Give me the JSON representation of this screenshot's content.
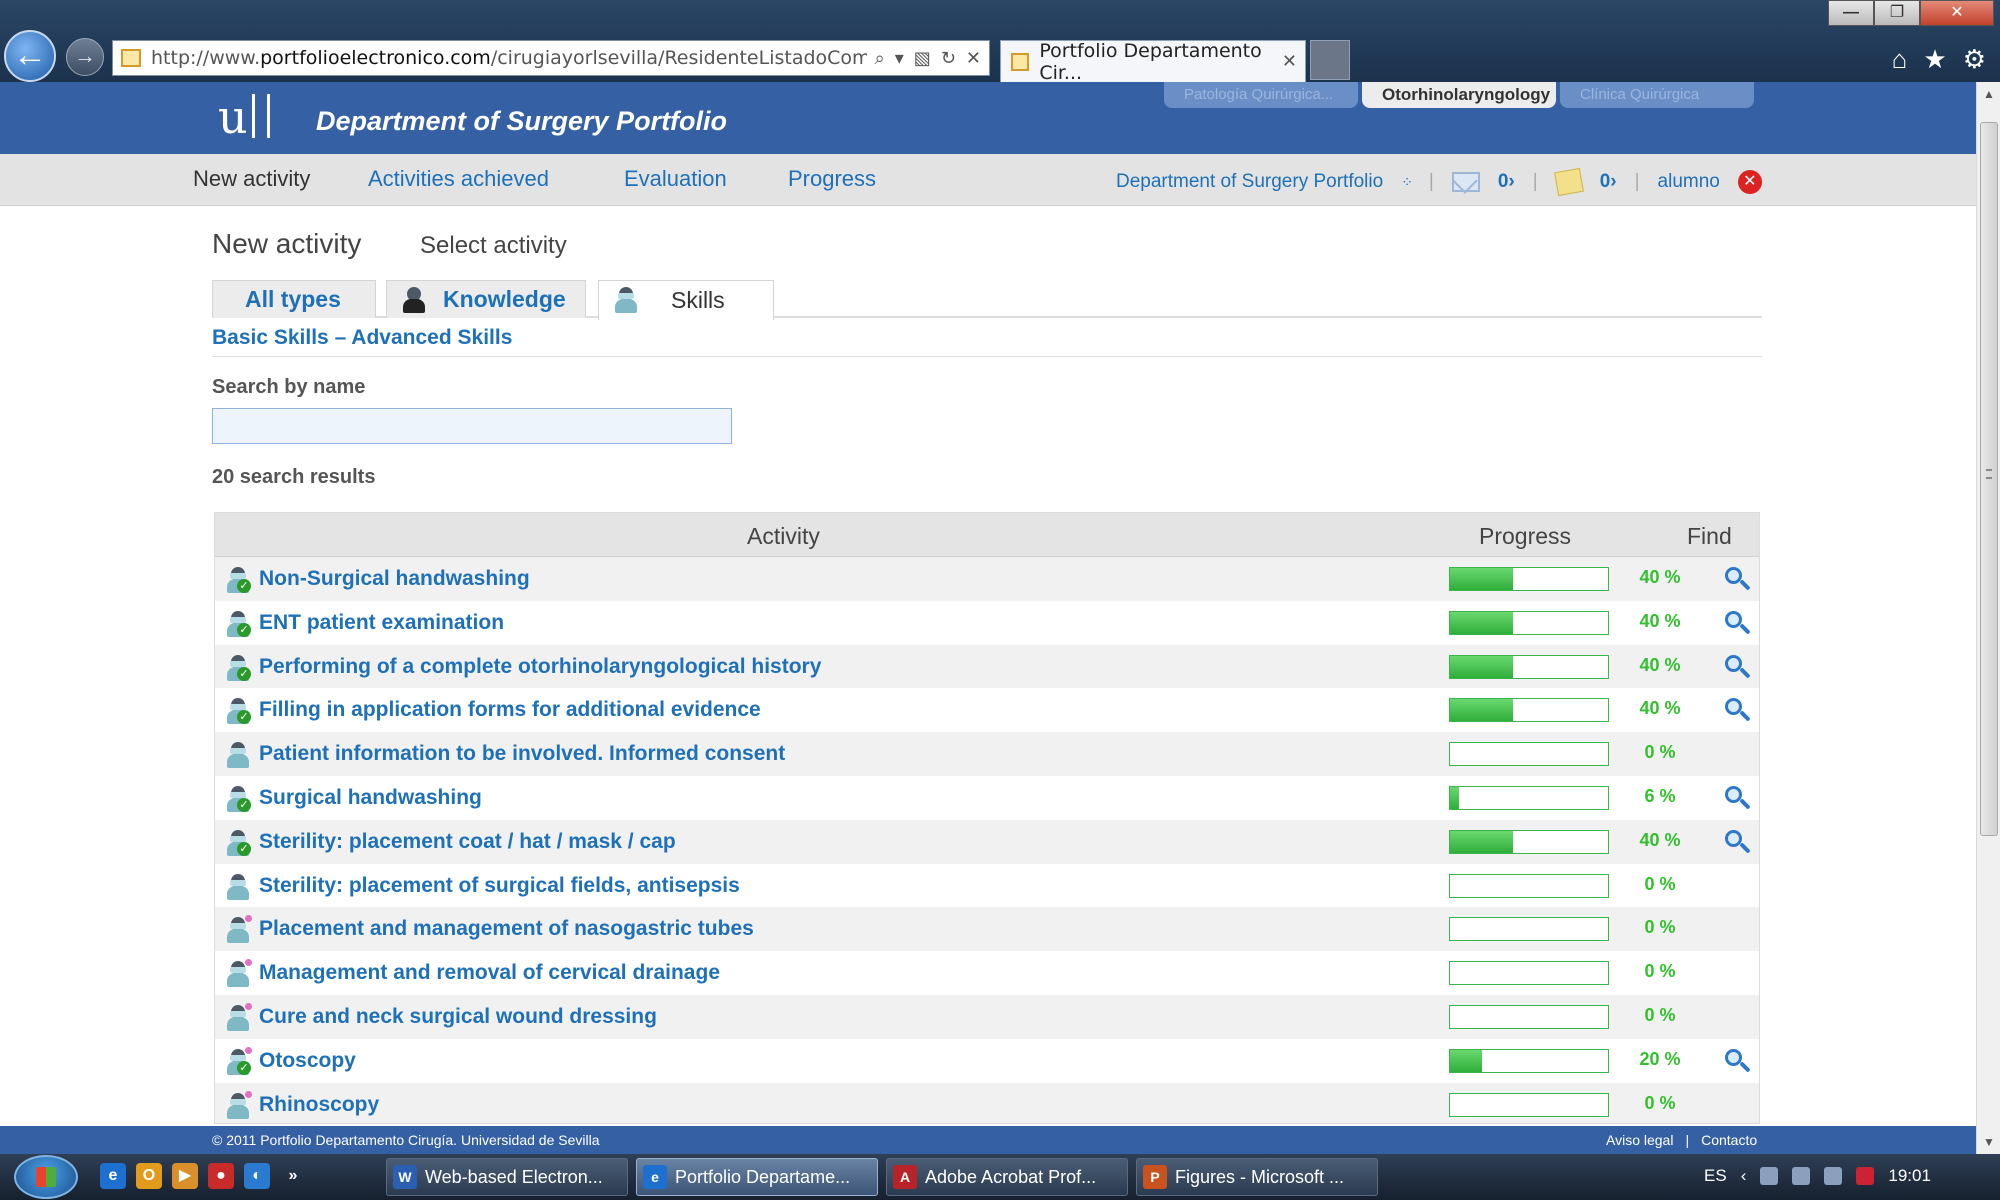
{
  "browser": {
    "url_prefix": "http://www.",
    "url_domain": "portfolioelectronico.com",
    "url_path": "/cirugiayorlsevilla/ResidenteListadoCompetenci",
    "tab_title": "Portfolio Departamento Cir...",
    "window_controls": [
      "—",
      "❐",
      "✕"
    ]
  },
  "site": {
    "title": "Department of Surgery Portfolio",
    "subject_tabs": [
      "Patología Quirúrgica...",
      "Otorhinolaryngology",
      "Clínica Quirúrgica"
    ],
    "active_subject": "Otorhinolaryngology"
  },
  "nav": {
    "items": [
      "New activity",
      "Activities achieved",
      "Evaluation",
      "Progress"
    ],
    "portfolio_link": "Department of Surgery Portfolio",
    "messages": "0›",
    "notes": "0›",
    "user": "alumno"
  },
  "page": {
    "heading": "New activity",
    "subheading": "Select activity",
    "type_tabs": [
      "All types",
      "Knowledge",
      "Skills"
    ],
    "active_type": "Skills",
    "crumb": "Basic Skills – Advanced Skills",
    "search_label": "Search by name",
    "search_value": "",
    "result_count": "20 search results"
  },
  "table": {
    "columns": [
      "Activity",
      "Progress",
      "Find"
    ],
    "rows": [
      {
        "activity": "Non-Surgical handwashing",
        "progress": 40,
        "progress_label": "40 %",
        "find": true,
        "icon": "skill-done"
      },
      {
        "activity": "ENT patient examination",
        "progress": 40,
        "progress_label": "40 %",
        "find": true,
        "icon": "skill-done"
      },
      {
        "activity": "Performing of a complete otorhinolaryngological history",
        "progress": 40,
        "progress_label": "40 %",
        "find": true,
        "icon": "skill-done"
      },
      {
        "activity": "Filling in application forms for additional evidence",
        "progress": 40,
        "progress_label": "40 %",
        "find": true,
        "icon": "skill-done"
      },
      {
        "activity": "Patient information to be involved. Informed consent",
        "progress": 0,
        "progress_label": "0 %",
        "find": false,
        "icon": "skill"
      },
      {
        "activity": "Surgical handwashing",
        "progress": 6,
        "progress_label": "6 %",
        "find": true,
        "icon": "skill-done"
      },
      {
        "activity": "Sterility: placement coat / hat / mask / cap",
        "progress": 40,
        "progress_label": "40 %",
        "find": true,
        "icon": "skill-done"
      },
      {
        "activity": "Sterility: placement of surgical fields, antisepsis",
        "progress": 0,
        "progress_label": "0 %",
        "find": false,
        "icon": "skill"
      },
      {
        "activity": "Placement and management of nasogastric tubes",
        "progress": 0,
        "progress_label": "0 %",
        "find": false,
        "icon": "skill-advanced"
      },
      {
        "activity": "Management and removal of cervical drainage",
        "progress": 0,
        "progress_label": "0 %",
        "find": false,
        "icon": "skill-advanced"
      },
      {
        "activity": "Cure and neck surgical wound dressing",
        "progress": 0,
        "progress_label": "0 %",
        "find": false,
        "icon": "skill-advanced"
      },
      {
        "activity": "Otoscopy",
        "progress": 20,
        "progress_label": "20 %",
        "find": true,
        "icon": "skill-advanced-done"
      },
      {
        "activity": "Rhinoscopy",
        "progress": 0,
        "progress_label": "0 %",
        "find": false,
        "icon": "skill-advanced"
      },
      {
        "activity": "",
        "progress": 0,
        "progress_label": "",
        "find": false,
        "icon": "skill-advanced"
      }
    ]
  },
  "footer": {
    "copyright": "© 2011 Portfolio Departamento Cirugía. Universidad de Sevilla",
    "links": [
      "Aviso legal",
      "|",
      "Contacto"
    ]
  },
  "taskbar": {
    "tasks": [
      "Web-based Electron...",
      "Portfolio Departame...",
      "Adobe Acrobat Prof...",
      "Figures - Microsoft ..."
    ],
    "active_task": "Portfolio Departame...",
    "language": "ES",
    "clock": "19:01",
    "overflow": "»"
  },
  "colors": {
    "header_blue": "#3560a3",
    "link_blue": "#1e70b8",
    "progress_green": "#33c02e"
  }
}
